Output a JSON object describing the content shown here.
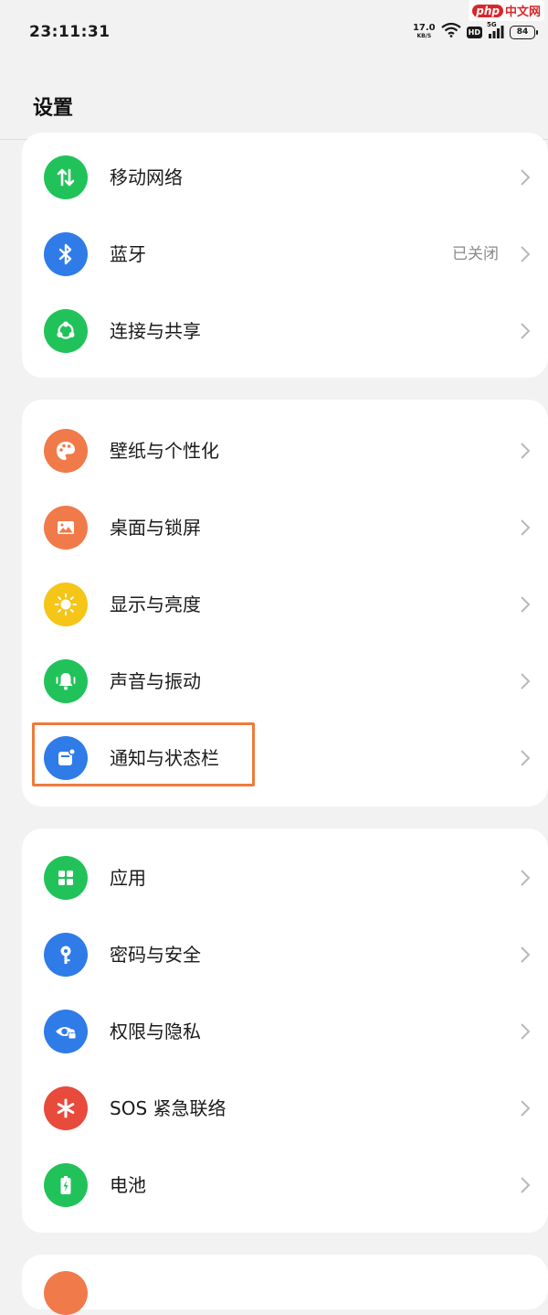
{
  "status_bar": {
    "time": "23:11:31",
    "net_speed_value": "17.0",
    "net_speed_unit": "KB/S",
    "hd_badge": "HD",
    "network_type": "5G",
    "battery_level": "84"
  },
  "watermark": {
    "brand": "php",
    "site": "中文网"
  },
  "header": {
    "title": "设置"
  },
  "groups": [
    {
      "items": [
        {
          "label": "移动网络",
          "icon": "mobile-data-icon",
          "color": "#22c25a"
        },
        {
          "label": "蓝牙",
          "value": "已关闭",
          "icon": "bluetooth-icon",
          "color": "#2f7be8"
        },
        {
          "label": "连接与共享",
          "icon": "share-icon",
          "color": "#22c25a"
        }
      ]
    },
    {
      "items": [
        {
          "label": "壁纸与个性化",
          "icon": "palette-icon",
          "color": "#f07a4a"
        },
        {
          "label": "桌面与锁屏",
          "icon": "image-icon",
          "color": "#f07a4a"
        },
        {
          "label": "显示与亮度",
          "icon": "sun-icon",
          "color": "#f5c518"
        },
        {
          "label": "声音与振动",
          "icon": "bell-icon",
          "color": "#22c25a"
        },
        {
          "label": "通知与状态栏",
          "icon": "notification-icon",
          "color": "#2f7be8",
          "highlighted": true
        }
      ]
    },
    {
      "items": [
        {
          "label": "应用",
          "icon": "apps-grid-icon",
          "color": "#22c25a"
        },
        {
          "label": "密码与安全",
          "icon": "key-icon",
          "color": "#2f7be8"
        },
        {
          "label": "权限与隐私",
          "icon": "privacy-eye-icon",
          "color": "#2f7be8"
        },
        {
          "label": "SOS 紧急联络",
          "icon": "sos-asterisk-icon",
          "color": "#e84a3c"
        },
        {
          "label": "电池",
          "icon": "battery-icon",
          "color": "#22c25a"
        }
      ]
    }
  ],
  "highlight_color": "#f07a3a"
}
